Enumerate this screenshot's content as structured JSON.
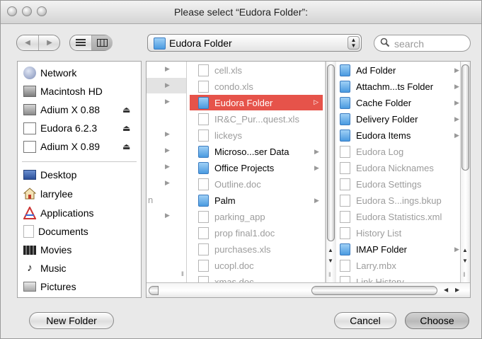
{
  "window": {
    "title": "Please select “Eudora Folder”:"
  },
  "toolbar": {
    "back_glyph": "◀",
    "forward_glyph": "▶",
    "location": "Eudora Folder",
    "search_placeholder": "search"
  },
  "sidebar": {
    "devices": [
      {
        "label": "Network",
        "icon": "network-icon",
        "eject": false
      },
      {
        "label": "Macintosh HD",
        "icon": "hard-disk-icon",
        "eject": false
      },
      {
        "label": "Adium X 0.88",
        "icon": "disk-image-icon",
        "eject": true
      },
      {
        "label": "Eudora 6.2.3",
        "icon": "disk-image-icon",
        "eject": true
      },
      {
        "label": "Adium X 0.89",
        "icon": "disk-image-icon",
        "eject": true
      }
    ],
    "places": [
      {
        "label": "Desktop",
        "icon": "desktop-icon"
      },
      {
        "label": "larrylee",
        "icon": "home-icon"
      },
      {
        "label": "Applications",
        "icon": "applications-icon"
      },
      {
        "label": "Documents",
        "icon": "documents-icon"
      },
      {
        "label": "Movies",
        "icon": "movies-icon"
      },
      {
        "label": "Music",
        "icon": "music-icon"
      },
      {
        "label": "Pictures",
        "icon": "pictures-icon"
      }
    ],
    "eject_glyph": "⏏"
  },
  "column0": {
    "partial_text": "n"
  },
  "column1": {
    "items": [
      {
        "label": "cell.xls",
        "kind": "doc",
        "dim": true,
        "arrow": false
      },
      {
        "label": "condo.xls",
        "kind": "doc",
        "dim": true,
        "arrow": false
      },
      {
        "label": "Eudora Folder",
        "kind": "folder",
        "dim": false,
        "arrow": true,
        "selected": true
      },
      {
        "label": "IR&C_Pur...quest.xls",
        "kind": "doc",
        "dim": true,
        "arrow": false
      },
      {
        "label": "lickeys",
        "kind": "doc",
        "dim": true,
        "arrow": false
      },
      {
        "label": "Microso...ser Data",
        "kind": "folder",
        "dim": false,
        "arrow": true
      },
      {
        "label": "Office Projects",
        "kind": "folder",
        "dim": false,
        "arrow": true
      },
      {
        "label": "Outline.doc",
        "kind": "doc",
        "dim": true,
        "arrow": false
      },
      {
        "label": "Palm",
        "kind": "folder",
        "dim": false,
        "arrow": true
      },
      {
        "label": "parking_app",
        "kind": "doc",
        "dim": true,
        "arrow": false
      },
      {
        "label": "prop final1.doc",
        "kind": "doc",
        "dim": true,
        "arrow": false
      },
      {
        "label": "purchases.xls",
        "kind": "doc",
        "dim": true,
        "arrow": false
      },
      {
        "label": "ucopl.doc",
        "kind": "doc",
        "dim": true,
        "arrow": false
      },
      {
        "label": "xmas.doc",
        "kind": "doc",
        "dim": true,
        "arrow": false
      }
    ]
  },
  "column2": {
    "items": [
      {
        "label": "Ad Folder",
        "kind": "folder",
        "dim": false,
        "arrow": true
      },
      {
        "label": "Attachm...ts Folder",
        "kind": "folder",
        "dim": false,
        "arrow": true
      },
      {
        "label": "Cache Folder",
        "kind": "folder",
        "dim": false,
        "arrow": true
      },
      {
        "label": "Delivery Folder",
        "kind": "folder",
        "dim": false,
        "arrow": true
      },
      {
        "label": "Eudora Items",
        "kind": "folder",
        "dim": false,
        "arrow": true
      },
      {
        "label": "Eudora Log",
        "kind": "doc",
        "dim": true,
        "arrow": false
      },
      {
        "label": "Eudora Nicknames",
        "kind": "doc",
        "dim": true,
        "arrow": false
      },
      {
        "label": "Eudora Settings",
        "kind": "doc",
        "dim": true,
        "arrow": false
      },
      {
        "label": "Eudora S...ings.bkup",
        "kind": "doc",
        "dim": true,
        "arrow": false
      },
      {
        "label": "Eudora Statistics.xml",
        "kind": "doc",
        "dim": true,
        "arrow": false
      },
      {
        "label": "History List",
        "kind": "doc",
        "dim": true,
        "arrow": false
      },
      {
        "label": "IMAP Folder",
        "kind": "folder",
        "dim": false,
        "arrow": true
      },
      {
        "label": "Larry.mbx",
        "kind": "doc",
        "dim": true,
        "arrow": false
      },
      {
        "label": "Link History",
        "kind": "doc",
        "dim": true,
        "arrow": false
      }
    ]
  },
  "buttons": {
    "new_folder": "New Folder",
    "cancel": "Cancel",
    "choose": "Choose"
  },
  "colors": {
    "selection": "#e6534a",
    "folder": "#4a9ae0"
  }
}
